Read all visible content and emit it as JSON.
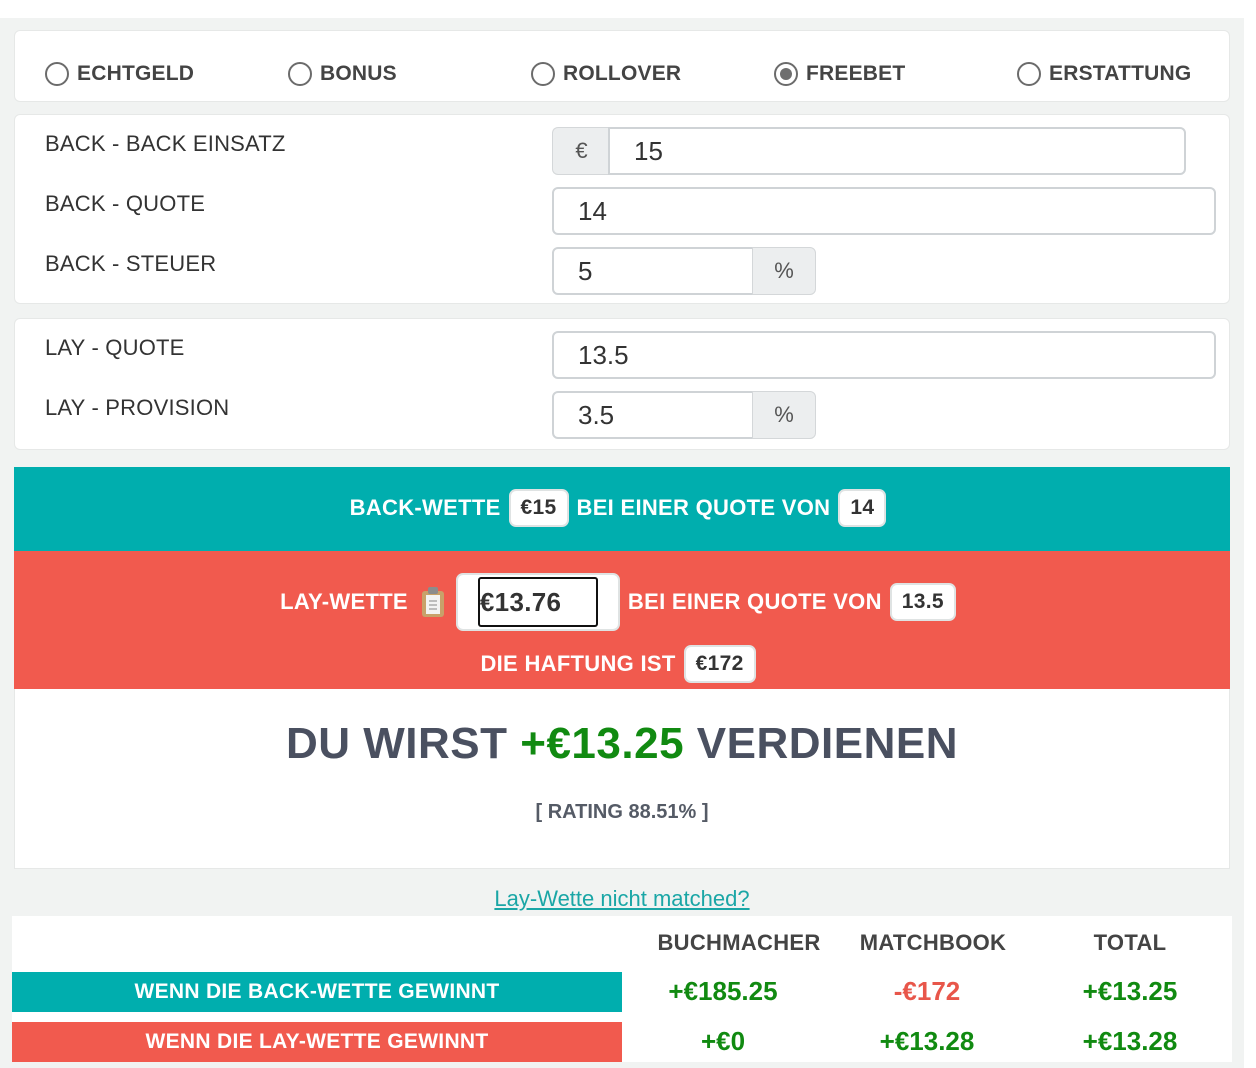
{
  "modes": {
    "options": [
      "ECHTGELD",
      "BONUS",
      "ROLLOVER",
      "FREEBET",
      "ERSTATTUNG"
    ],
    "selected": "FREEBET"
  },
  "back": {
    "stake_label": "BACK - BACK EINSATZ",
    "currency": "€",
    "stake_value": "15",
    "odds_label": "BACK - QUOTE",
    "odds_value": "14",
    "tax_label": "BACK - STEUER",
    "tax_value": "5",
    "tax_unit": "%"
  },
  "lay": {
    "odds_label": "LAY - QUOTE",
    "odds_value": "13.5",
    "commission_label": "LAY - PROVISION",
    "commission_value": "3.5",
    "commission_unit": "%"
  },
  "back_banner": {
    "prefix": "BACK-WETTE",
    "stake": "€15",
    "middle": "BEI EINER QUOTE VON",
    "odds": "14"
  },
  "lay_banner": {
    "prefix": "LAY-WETTE",
    "stake": "€13.76",
    "middle": "BEI EINER QUOTE VON",
    "odds": "13.5",
    "liability_label": "DIE HAFTUNG IST",
    "liability": "€172"
  },
  "result": {
    "prefix": "DU WIRST",
    "profit": "+€13.25",
    "suffix": "VERDIENEN",
    "rating": "[ RATING 88.51% ]"
  },
  "unmatched_link": "Lay-Wette nicht matched?",
  "table": {
    "headers": [
      "BUCHMACHER",
      "MATCHBOOK",
      "TOTAL"
    ],
    "rows": [
      {
        "label": "WENN DIE BACK-WETTE GEWINNT",
        "bookmaker": "+€185.25",
        "exchange": "-€172",
        "total": "+€13.25"
      },
      {
        "label": "WENN DIE LAY-WETTE GEWINNT",
        "bookmaker": "+€0",
        "exchange": "+€13.28",
        "total": "+€13.28"
      }
    ]
  },
  "colors": {
    "back": "#00aeae",
    "lay": "#f15a4e",
    "positive": "#118a11",
    "negative": "#e8564a",
    "link": "#1aa6a6"
  },
  "icons": [
    "clipboard-icon"
  ]
}
